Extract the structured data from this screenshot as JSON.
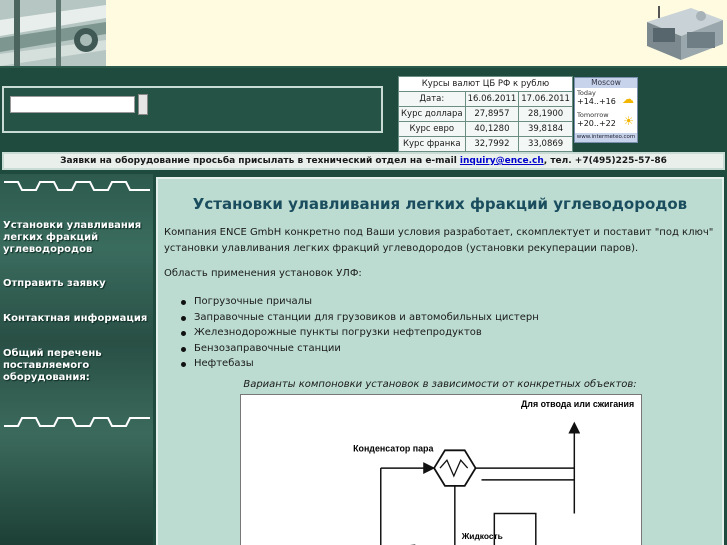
{
  "header": {
    "left_image": "industrial-pipes-photo",
    "right_image": "recovery-unit-photo"
  },
  "search": {
    "placeholder": ""
  },
  "currency_table": {
    "caption": "Курсы валют ЦБ РФ к рублю",
    "date_label": "Дата:",
    "dates": [
      "16.06.2011",
      "17.06.2011"
    ],
    "rows": [
      {
        "label": "Курс доллара",
        "values": [
          "27,8957",
          "28,1900"
        ]
      },
      {
        "label": "Курс евро",
        "values": [
          "40,1280",
          "39,8184"
        ]
      },
      {
        "label": "Курс франка",
        "values": [
          "32,7992",
          "33,0869"
        ]
      }
    ]
  },
  "weather": {
    "city": "Moscow",
    "today_label": "Today",
    "today_temp": "+14..+16",
    "tomorrow_label": "Tomorrow",
    "tomorrow_temp": "+20..+22",
    "source": "www.intermeteo.com",
    "today_icon": "partly-cloudy-icon",
    "tomorrow_icon": "sun-icon"
  },
  "notice": {
    "text_before": "Заявки на оборудование просьба присылать в технический отдел на e-mail ",
    "email": "inquiry@ence.ch",
    "text_after": ", тел. +7(495)225-57-86"
  },
  "sidebar": {
    "items": [
      {
        "label": "Установки улавливания легких фракций углеводородов"
      },
      {
        "label": "Отправить заявку"
      },
      {
        "label": "Контактная информация"
      },
      {
        "label": "Общий перечень поставляемого оборудования:"
      }
    ]
  },
  "main": {
    "title": "Установки улавливания легких фракций углеводородов",
    "intro": "Компания ENCE GmbH конкретно под Ваши условия разработает, скомплектует и поставит \"под ключ\" установки улавливания легких фракций углеводородов (установки рекуперации паров).",
    "scope_heading": "Область применения установок УЛФ:",
    "scope_items": [
      "Погрузочные причалы",
      "Заправочные станции для грузовиков и автомобильных цистерн",
      "Железнодорожные пункты погрузки нефтепродуктов",
      "Бензозаправочные станции",
      "Нефтебазы"
    ],
    "caption": "Варианты компоновки установок в зависимости от конкретных объектов:",
    "diagram": {
      "label_top": "Для отвода или сжигания",
      "label_condenser": "Конденсатор пара",
      "label_liquid": "Жидкость"
    }
  },
  "colors": {
    "page_bg": "#1f4a3e",
    "banner_bg": "#fffbe0",
    "content_bg": "#bcdcd2",
    "title_color": "#1a4d5e",
    "link_color": "#0000cc"
  }
}
